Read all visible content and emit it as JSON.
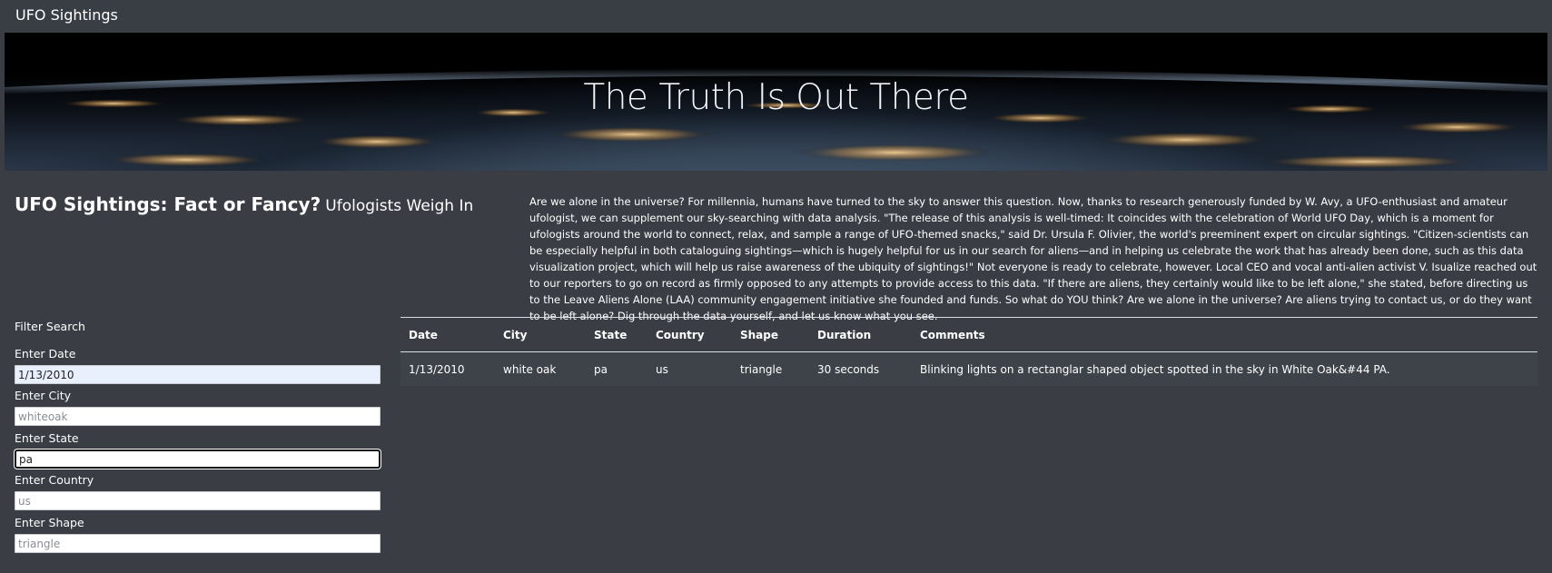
{
  "navbar": {
    "brand": "UFO Sightings"
  },
  "hero": {
    "title": "The Truth Is Out There"
  },
  "heading": {
    "main": "UFO Sightings: Fact or Fancy?",
    "sub": "Ufologists Weigh In"
  },
  "intro": {
    "text": "Are we alone in the universe? For millennia, humans have turned to the sky to answer this question. Now, thanks to research generously funded by W. Avy, a UFO-enthusiast and amateur ufologist, we can supplement our sky-searching with data analysis. \"The release of this analysis is well-timed: It coincides with the celebration of World UFO Day, which is a moment for ufologists around the world to connect, relax, and sample a range of UFO-themed snacks,\" said Dr. Ursula F. Olivier, the world's preeminent expert on circular sightings. \"Citizen-scientists can be especially helpful in both cataloguing sightings—which is hugely helpful for us in our search for aliens—and in helping us celebrate the work that has already been done, such as this data visualization project, which will help us raise awareness of the ubiquity of sightings!\" Not everyone is ready to celebrate, however. Local CEO and vocal anti-alien activist V. Isualize reached out to our reporters to go on record as firmly opposed to any attempts to provide access to this data. \"If there are aliens, they certainly would like to be left alone,\" she stated, before directing us to the Leave Aliens Alone (LAA) community engagement initiative she founded and funds. So what do YOU think? Are we alone in the universe? Are aliens trying to contact us, or do they want to be left alone? Dig through the data yourself, and let us know what you see."
  },
  "filters": {
    "title": "Filter Search",
    "date": {
      "label": "Enter Date",
      "value": "1/13/2010",
      "placeholder": ""
    },
    "city": {
      "label": "Enter City",
      "value": "",
      "placeholder": "whiteoak"
    },
    "state": {
      "label": "Enter State",
      "value": "pa",
      "placeholder": ""
    },
    "country": {
      "label": "Enter Country",
      "value": "",
      "placeholder": "us"
    },
    "shape": {
      "label": "Enter Shape",
      "value": "",
      "placeholder": "triangle"
    }
  },
  "table": {
    "columns": [
      "Date",
      "City",
      "State",
      "Country",
      "Shape",
      "Duration",
      "Comments"
    ],
    "rows": [
      [
        "1/13/2010",
        "white oak",
        "pa",
        "us",
        "triangle",
        "30 seconds",
        "Blinking lights on a rectanglar shaped object spotted in the sky in White Oak&#44 PA."
      ]
    ]
  }
}
